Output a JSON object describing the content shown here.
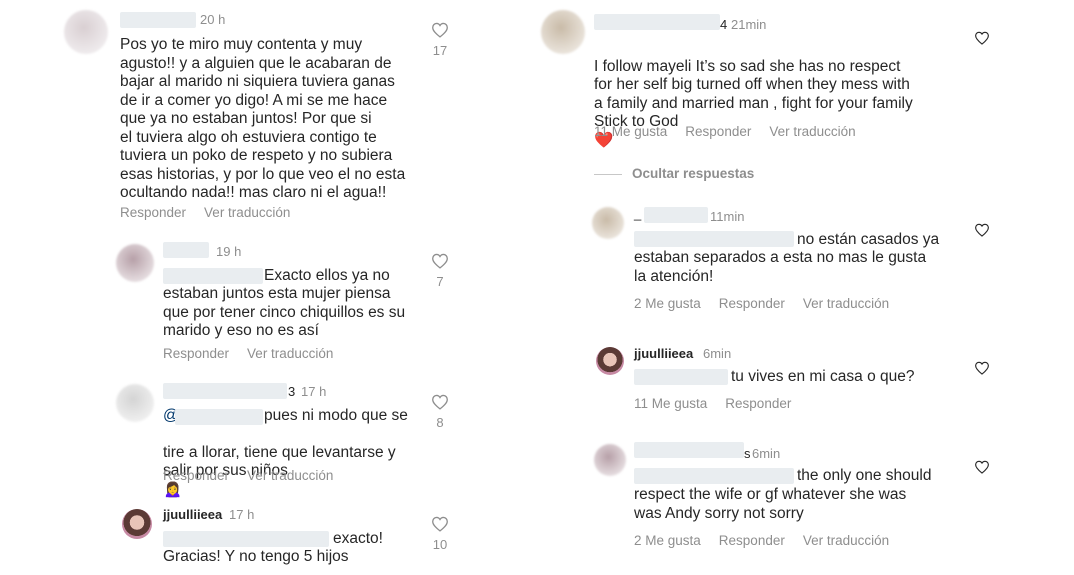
{
  "left": {
    "c1": {
      "time": "20 h",
      "text": "Pos yo te miro muy contenta y muy\nagusto!! y a alguien que le acabaran de\nbajar al marido ni siquiera tuviera ganas\nde ir a comer yo digo! A mi se me hace\nque ya no estaban juntos! Por que si\nel tuviera algo oh estuviera contigo te\ntuviera un poko de respeto y no subiera\nesas historias, y por lo que veo el no esta\nocultando nada!! mas claro ni el agua!!",
      "reply": "Responder",
      "translate": "Ver traducción",
      "likes": "17"
    },
    "c2": {
      "time": "19 h",
      "text_first": "Exacto ellos ya no",
      "text_rest": "estaban juntos esta mujer piensa\nque por tener cinco chiquillos es su\nmarido y eso no es así",
      "reply": "Responder",
      "translate": "Ver traducción",
      "likes": "7"
    },
    "c3": {
      "name_tail": "3",
      "time": "17 h",
      "mention_prefix": "@",
      "text_first": "pues ni modo que se",
      "text_rest": "tire a llorar, tiene que levantarse y\nsalir por sus niños",
      "emoji": "🙍‍♀️",
      "reply": "Responder",
      "translate": "Ver traducción",
      "likes": "8"
    },
    "c4": {
      "name": "jjuulliieea",
      "time": "17 h",
      "text_first": "exacto!",
      "text_rest": "Gracias! Y no tengo 5 hijos",
      "likes": "10"
    }
  },
  "right": {
    "r1": {
      "name_tail": "4",
      "time": "21min",
      "text": "I follow mayeli It’s so sad she has no respect\nfor her self big turned off when they mess with\na family and married man , fight for your family\nStick to God",
      "emoji": "❤️",
      "likes_label": "11 Me gusta",
      "reply": "Responder",
      "translate": "Ver traducción"
    },
    "hide_replies": "Ocultar respuestas",
    "r2": {
      "name_prefix": "_",
      "time": "11min",
      "text_first": "no están casados ya",
      "text_rest": "estaban separados a esta no mas le gusta\nla atención!",
      "likes_label": "2 Me gusta",
      "reply": "Responder",
      "translate": "Ver traducción"
    },
    "r3": {
      "name": "jjuulliieea",
      "time": "6min",
      "text_first": "tu vives en mi casa o que?",
      "likes_label": "11 Me gusta",
      "reply": "Responder"
    },
    "r4": {
      "name_tail": "s",
      "time": "6min",
      "text_first": "the only one should",
      "text_rest": "respect the wife or gf whatever she was\nwas Andy sorry not sorry",
      "likes_label": "2 Me gusta",
      "reply": "Responder",
      "translate": "Ver traducción"
    }
  },
  "icons": {
    "heart": "heart-outline-icon"
  },
  "colors": {
    "text": "#262626",
    "muted": "#8e8e8e",
    "like_red": "#e8202f"
  }
}
